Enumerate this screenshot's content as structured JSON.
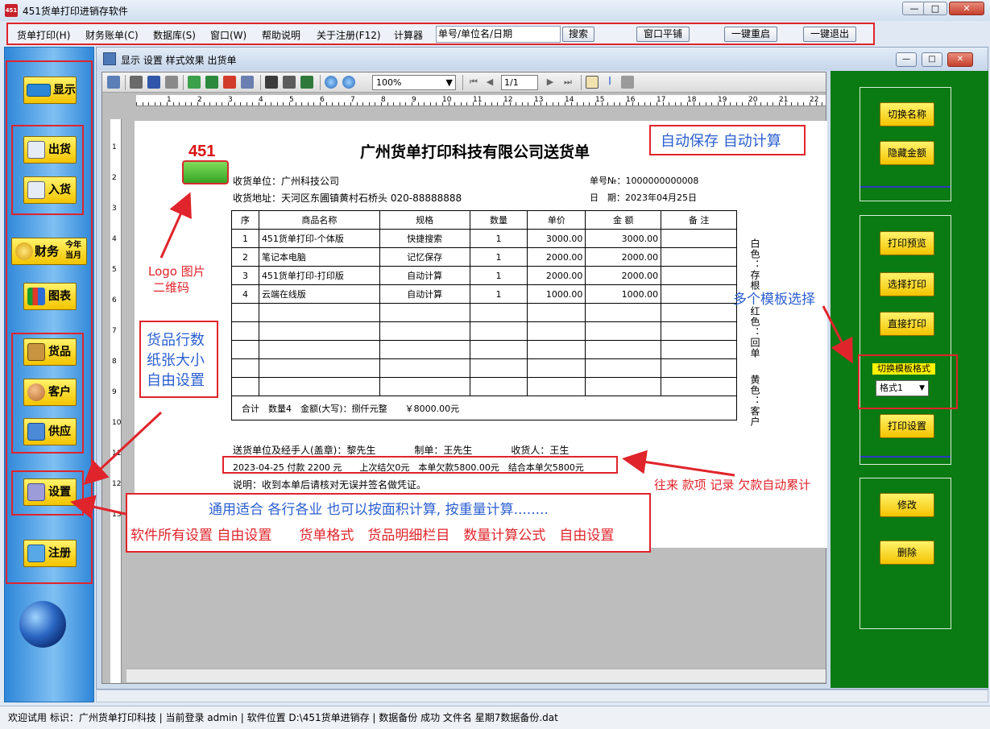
{
  "window": {
    "title": "451货单打印进销存软件",
    "icon_label": "451",
    "minimize": "—",
    "maximize": "□",
    "close": "✕"
  },
  "menu": {
    "items": [
      "货单打印(H)",
      "财务账单(C)",
      "数据库(S)",
      "窗口(W)",
      "帮助说明",
      "关于注册(F12)",
      "计算器"
    ],
    "search_value": "单号/单位名/日期",
    "search_button": "搜索",
    "tile_button": "窗口平铺",
    "restart_button": "一键重启",
    "exit_button": "一键退出"
  },
  "sidebar": {
    "show": "显示",
    "outgoing": "出货",
    "incoming": "入货",
    "finance": "财务",
    "finance_sub1": "今年",
    "finance_sub2": "当月",
    "chart": "图表",
    "goods": "货品",
    "customer": "客户",
    "supplier": "供应",
    "settings": "设置",
    "register": "注册"
  },
  "child": {
    "title": "显示 设置 样式效果 出货单",
    "minimize": "—",
    "maximize": "□",
    "close": "✕"
  },
  "viewer": {
    "zoom": "100%",
    "page": "1/1",
    "ruler_numbers": [
      "1",
      "2",
      "3",
      "4",
      "5",
      "6",
      "7",
      "8",
      "9",
      "10",
      "11",
      "12",
      "13",
      "14",
      "15",
      "16",
      "17",
      "18",
      "19",
      "20",
      "21",
      "22"
    ],
    "vruler_numbers": [
      "1",
      "2",
      "3",
      "4",
      "5",
      "6",
      "7",
      "8",
      "9",
      "10",
      "11",
      "12",
      "13"
    ]
  },
  "doc": {
    "logo_number": "451",
    "title": "广州货单打印科技有限公司送货单",
    "receiver_label": "收货单位：",
    "receiver": "广州科技公司",
    "address_label": "收货地址：",
    "address": "天河区东圃镇黄村石桥头 020-88888888",
    "order_no_label": "单号№：",
    "order_no": "1000000000008",
    "date_label": "日　期：",
    "date": "2023年04月25日",
    "columns": [
      "序",
      "商品名称",
      "规格",
      "数量",
      "单价",
      "金 额",
      "备 注"
    ],
    "rows": [
      [
        "1",
        "451货单打印-个体版",
        "快捷搜索",
        "1",
        "3000.00",
        "3000.00",
        ""
      ],
      [
        "2",
        "笔记本电脑",
        "记忆保存",
        "1",
        "2000.00",
        "2000.00",
        ""
      ],
      [
        "3",
        "451货单打印-打印版",
        "自动计算",
        "1",
        "2000.00",
        "2000.00",
        ""
      ],
      [
        "4",
        "云端在线版",
        "自动计算",
        "1",
        "1000.00",
        "1000.00",
        ""
      ],
      [
        "",
        "",
        "",
        "",
        "",
        "",
        ""
      ],
      [
        "",
        "",
        "",
        "",
        "",
        "",
        ""
      ],
      [
        "",
        "",
        "",
        "",
        "",
        "",
        ""
      ],
      [
        "",
        "",
        "",
        "",
        "",
        "",
        ""
      ],
      [
        "",
        "",
        "",
        "",
        "",
        "",
        ""
      ]
    ],
    "total": "合计　数量4　金额(大写)：捌仟元整　　￥8000.00元",
    "side_white": "白色：存根",
    "side_red": "红色：回单",
    "side_yellow": "黄色：客户",
    "signers": "送货单位及经手人(盖章)：黎先生　　　　制单：王先生　　　　收货人：王生",
    "payment": "2023-04-25 付款 2200 元　　上次结欠0元　本单欠款5800.00元　结合本单欠5800元",
    "note": "说明：收到本单后请核对无误并签名做凭证。"
  },
  "annotations": {
    "auto": "自动保存  自动计算",
    "logo1": "Logo 图片",
    "logo2": "二维码",
    "rows1": "货品行数",
    "rows2": "纸张大小",
    "rows3": "自由设置",
    "templates": "多个模板选择",
    "debt": "往来 款项 记录 欠款自动累计",
    "general": "通用适合 各行各业 也可以按面积计算, 按重量计算........",
    "settings_all": "软件所有设置 自由设置　　货单格式　货品明细栏目　数量计算公式　自由设置"
  },
  "right_panel": {
    "switch_name": "切换名称",
    "hide_amount": "隐藏金额",
    "print_preview": "打印预览",
    "select_print": "选择打印",
    "direct_print": "直接打印",
    "template_label": "切换模板格式",
    "template_value": "格式1",
    "print_settings": "打印设置",
    "modify": "修改",
    "delete": "删除"
  },
  "status": "欢迎试用 标识：广州货单打印科技 | 当前登录 admin | 软件位置 D:\\451货单进销存 | 数据备份 成功 文件名 星期7数据备份.dat",
  "colors": {
    "accent_red": "#e0242b",
    "annotation_blue": "#2b5fd0",
    "panel_green": "#0a7a13",
    "button_yellow": "#f3c400"
  }
}
